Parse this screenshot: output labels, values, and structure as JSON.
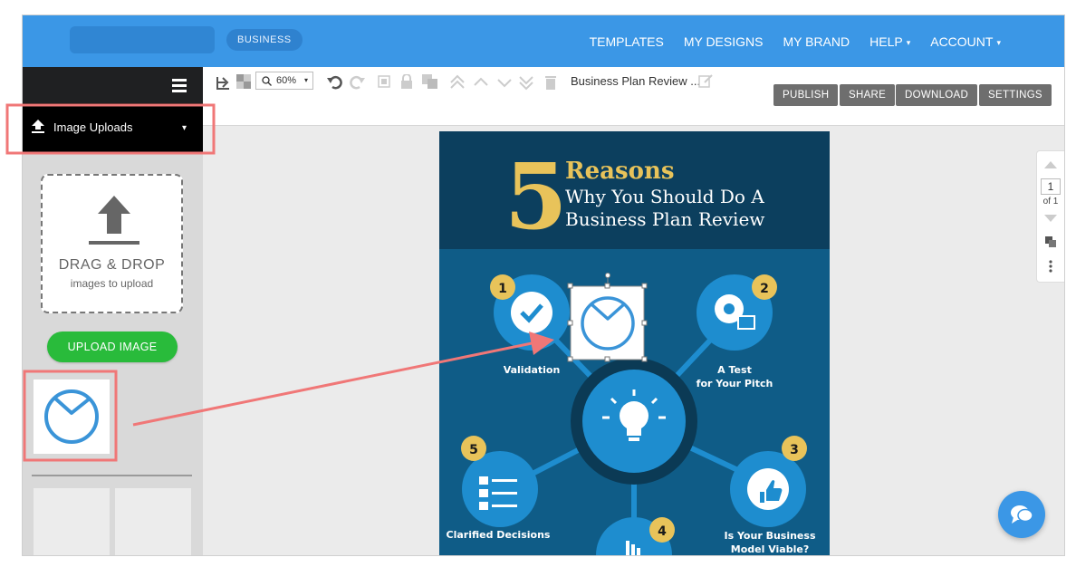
{
  "nav": {
    "badge": "BUSINESS",
    "items": [
      "TEMPLATES",
      "MY DESIGNS",
      "MY BRAND",
      "HELP",
      "ACCOUNT"
    ],
    "caret": "▾"
  },
  "sidebar": {
    "uploads_label": "Image Uploads",
    "dropdown_caret": "▾",
    "drop_title": "DRAG & DROP",
    "drop_sub": "images to upload",
    "upload_button": "UPLOAD IMAGE"
  },
  "toolbar": {
    "zoom": "60%",
    "zoom_caret": "▾",
    "doc_title": "Business Plan Review ...",
    "buttons": [
      "PUBLISH",
      "SHARE",
      "DOWNLOAD",
      "SETTINGS"
    ]
  },
  "page_nav": {
    "current": "1",
    "of": "of 1"
  },
  "poster": {
    "big_number": "5",
    "title_line1": "Reasons",
    "title_line2": "Why You Should Do A",
    "title_line3": "Business Plan Review",
    "items": [
      {
        "num": "1",
        "label": "Validation"
      },
      {
        "num": "2",
        "label_line1": "A Test",
        "label_line2": "for Your Pitch"
      },
      {
        "num": "3",
        "label_line1": "Is Your Business",
        "label_line2": "Model Viable?"
      },
      {
        "num": "4",
        "label": ""
      },
      {
        "num": "5",
        "label": "Clarified Decisions"
      }
    ]
  },
  "colors": {
    "nav_blue": "#3b97e6",
    "poster_dark": "#0c3f5e",
    "poster_mid": "#0f5c87",
    "circle_blue": "#1e8dcf",
    "gold": "#f2c94c",
    "highlight_red": "#f07777",
    "upload_green": "#29bb3b"
  },
  "icons": [
    "hamburger-icon",
    "upload-icon",
    "clock-image-icon",
    "undo-icon",
    "redo-icon",
    "lock-icon",
    "chat-icon",
    "lightbulb-icon",
    "gear-icon",
    "thumbs-up-icon",
    "checklist-icon",
    "checkmark-icon",
    "pointer-hand-icon"
  ]
}
